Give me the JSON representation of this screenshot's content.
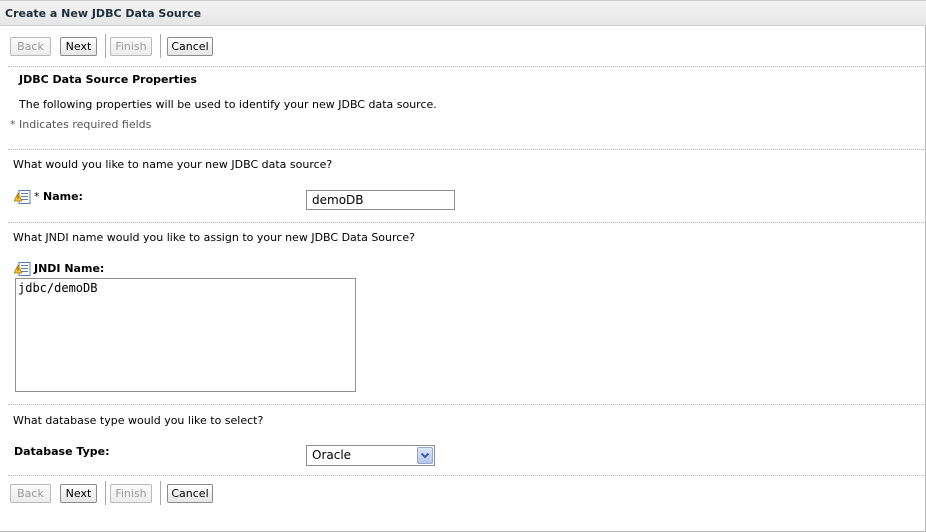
{
  "page": {
    "title": "Create a New JDBC Data Source"
  },
  "buttons": {
    "back": "Back",
    "next": "Next",
    "finish": "Finish",
    "cancel": "Cancel"
  },
  "section": {
    "heading": "JDBC Data Source Properties",
    "description": "The following properties will be used to identify your new JDBC data source.",
    "required_note": "* Indicates required fields"
  },
  "name_field": {
    "question": "What would you like to name your new JDBC data source?",
    "required_mark": "*",
    "label": "Name:",
    "value": "demoDB"
  },
  "jndi_field": {
    "question": "What JNDI name would you like to assign to your new JDBC Data Source?",
    "label": "JNDI Name:",
    "value": "jdbc/demoDB"
  },
  "db_type_field": {
    "question": "What database type would you like to select?",
    "label": "Database Type:",
    "selected": "Oracle"
  },
  "icons": {
    "info": "info-help-icon",
    "dropdown": "chevron-down-icon"
  },
  "colors": {
    "title_text": "#1f2d3a",
    "dropdown_arrow": "#3a5aa8"
  }
}
